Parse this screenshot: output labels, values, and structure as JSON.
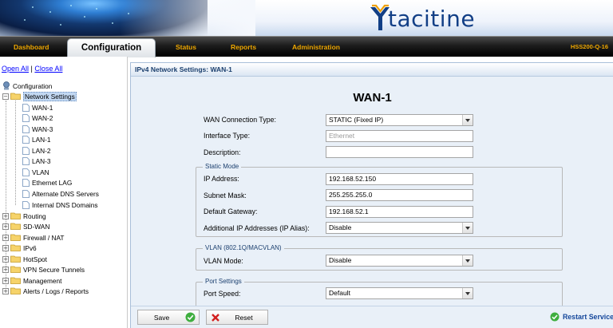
{
  "header": {
    "logo_text": "tacitine"
  },
  "nav": {
    "items": [
      "Dashboard",
      "Configuration",
      "Status",
      "Reports",
      "Administration"
    ],
    "active": "Configuration",
    "device": "HSS200-Q-16"
  },
  "left": {
    "open_all": "Open All",
    "separator": "|",
    "close_all": "Close All",
    "root": "Configuration",
    "network_settings": "Network Settings",
    "network_children": [
      "WAN-1",
      "WAN-2",
      "WAN-3",
      "LAN-1",
      "LAN-2",
      "LAN-3",
      "VLAN",
      "Ethernet LAG",
      "Alternate DNS Servers",
      "Internal DNS Domains"
    ],
    "folders": [
      "Routing",
      "SD-WAN",
      "Firewall / NAT",
      "IPv6",
      "HotSpot",
      "VPN Secure Tunnels",
      "Management",
      "Alerts / Logs / Reports"
    ]
  },
  "main": {
    "panel_title": "IPv4 Network Settings: WAN-1",
    "page_title": "WAN-1",
    "wan_connection_type": {
      "label": "WAN Connection Type:",
      "value": "STATIC (Fixed IP)"
    },
    "interface_type": {
      "label": "Interface Type:",
      "placeholder": "Ethernet"
    },
    "description": {
      "label": "Description:",
      "value": ""
    },
    "static_mode": {
      "legend": "Static Mode",
      "ip_address": {
        "label": "IP Address:",
        "value": "192.168.52.150"
      },
      "subnet_mask": {
        "label": "Subnet Mask:",
        "value": "255.255.255.0"
      },
      "default_gateway": {
        "label": "Default Gateway:",
        "value": "192.168.52.1"
      },
      "ip_alias": {
        "label": "Additional IP Addresses (IP Alias):",
        "value": "Disable"
      }
    },
    "vlan": {
      "legend": "VLAN (802.1Q/MACVLAN)",
      "mode": {
        "label": "VLAN Mode:",
        "value": "Disable"
      }
    },
    "port_settings": {
      "legend": "Port Settings",
      "speed": {
        "label": "Port Speed:",
        "value": "Default"
      }
    }
  },
  "footer": {
    "save": "Save",
    "reset": "Reset",
    "restart": "Restart Service"
  },
  "colors": {
    "nav_text": "#f0a800",
    "brand_blue": "#123f86",
    "panel_bg": "#e9f0f8"
  }
}
